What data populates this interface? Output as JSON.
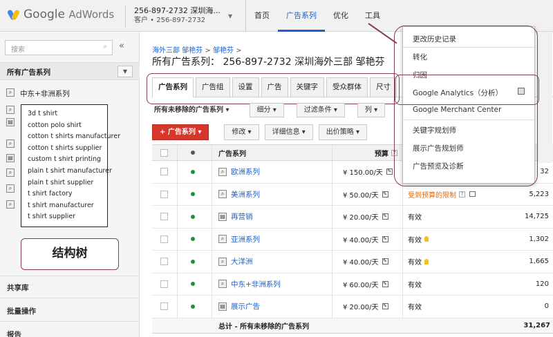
{
  "header": {
    "logo_brand": "Google",
    "logo_product": "AdWords",
    "account_line1": "256-897-2732 深圳海...",
    "account_line2": "客户 • 256-897-2732",
    "nav": [
      {
        "label": "首页"
      },
      {
        "label": "广告系列"
      },
      {
        "label": "优化"
      },
      {
        "label": "工具"
      }
    ]
  },
  "sidebar": {
    "search_placeholder": "搜索",
    "collapse_glyph": "«",
    "all_campaigns": "所有广告系列",
    "first_campaign": "中东+非洲系列",
    "tree_items": [
      "3d t shirt",
      "cotton polo shirt",
      "cotton t shirts manufacturer",
      "cotton t shirts supplier",
      "custom t shirt printing",
      "plain t shirt manufacturer",
      "plain t shirt supplier",
      "t shirt factory",
      "t shirt manufacturer",
      "t shirt supplier"
    ],
    "structure_note": "结构树",
    "sections": [
      "共享库",
      "批量操作",
      "报告"
    ]
  },
  "main": {
    "breadcrumb": [
      "海外三部 邹艳芬",
      "邹艳芬"
    ],
    "breadcrumb_sep": ">",
    "title": "所有广告系列： 256-897-2732 深圳海外三部 邹艳芬",
    "tabs": [
      "广告系列",
      "广告组",
      "设置",
      "广告",
      "关键字",
      "受众群体",
      "尺寸"
    ],
    "filters": [
      "所有未移除的广告系列 ▾",
      "细分 ▾",
      "过滤条件 ▾",
      "列 ▾"
    ],
    "actions": {
      "primary": "+ 广告系列 ▾",
      "items": [
        "修改 ▾",
        "详细信息 ▾",
        "出价策略 ▾"
      ]
    },
    "table": {
      "headers": {
        "campaign": "广告系列",
        "budget": "预算"
      },
      "rows": [
        {
          "icon": "search",
          "name": "欧洲系列",
          "budget": "¥ 150.00/天",
          "status": "",
          "value": "32"
        },
        {
          "icon": "search",
          "name": "美洲系列",
          "budget": "¥ 50.00/天",
          "status": "受到预算的限制",
          "value": "5,223"
        },
        {
          "icon": "display",
          "name": "再营销",
          "budget": "¥ 20.00/天",
          "status": "有效",
          "value": "14,725"
        },
        {
          "icon": "search",
          "name": "亚洲系列",
          "budget": "¥ 40.00/天",
          "status": "有效",
          "value": "1,302"
        },
        {
          "icon": "search",
          "name": "大洋洲",
          "budget": "¥ 40.00/天",
          "status": "有效",
          "value": "1,665"
        },
        {
          "icon": "search",
          "name": "中东+非洲系列",
          "budget": "¥ 60.00/天",
          "status": "有效",
          "value": "120"
        },
        {
          "icon": "display",
          "name": "展示广告",
          "budget": "¥ 20.00/天",
          "status": "有效",
          "value": "0"
        }
      ],
      "total_label": "总计 - 所有未移除的广告系列",
      "total_value": "31,267"
    }
  },
  "tools_menu": {
    "items": [
      "更改历史记录",
      "转化",
      "归因",
      "Google Analytics（分析）",
      "Google Merchant Center",
      "关键字规划师",
      "展示广告规划师",
      "广告预览及诊断"
    ]
  },
  "colors": {
    "accent_blue": "#1a5fce",
    "primary_red": "#d7372a",
    "annotation_maroon": "#8a3b5c",
    "status_green": "#1e8f3a",
    "warning_orange": "#e36b0b"
  }
}
